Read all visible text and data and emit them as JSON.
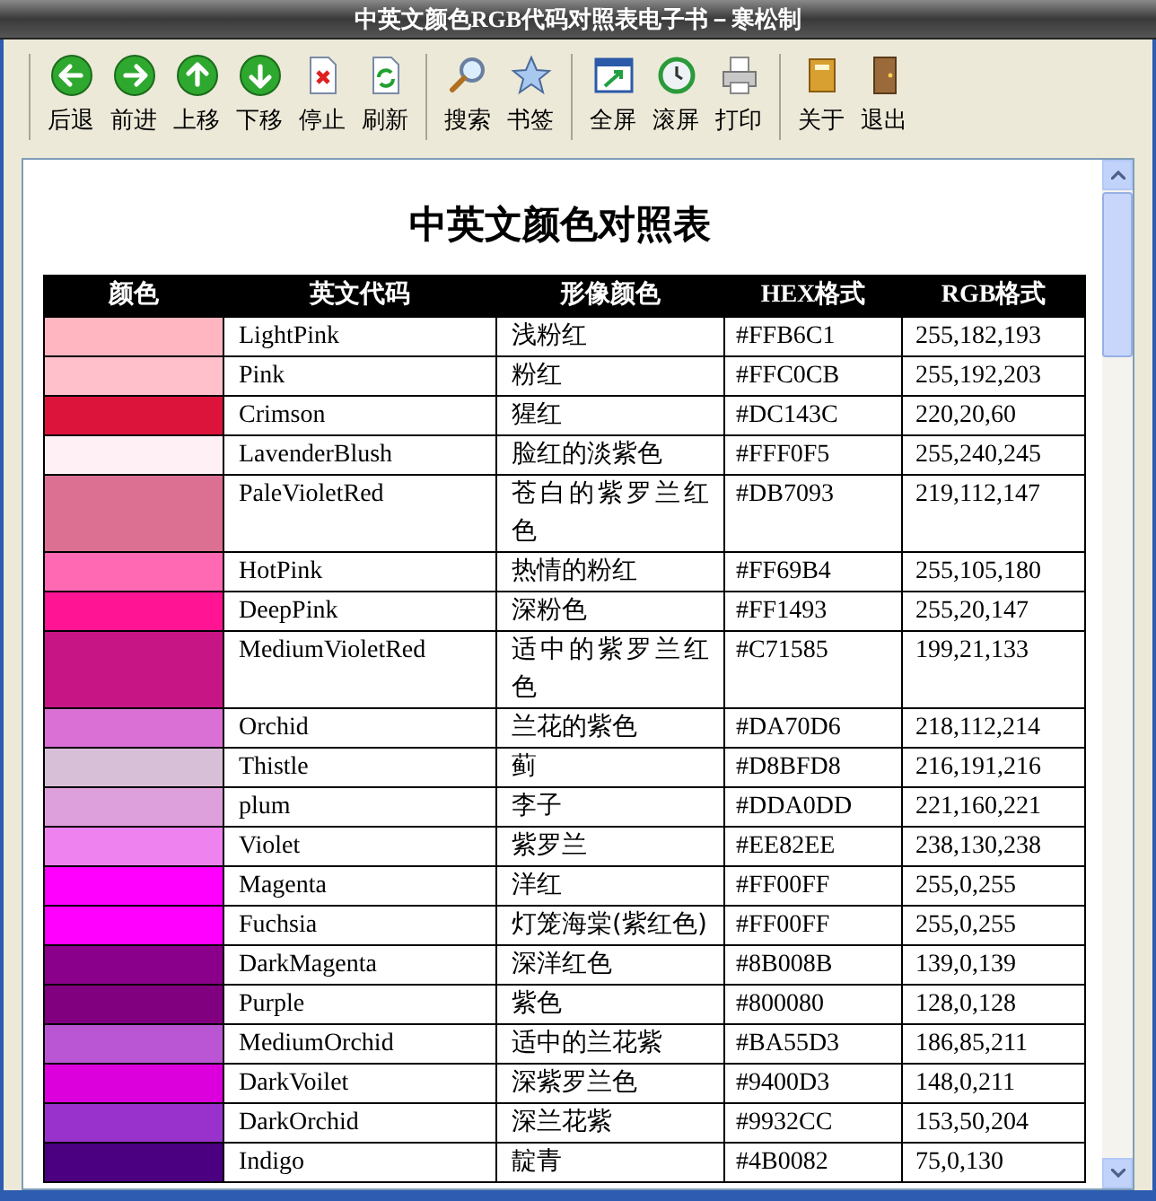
{
  "window": {
    "title": "中英文颜色RGB代码对照表电子书－寒松制"
  },
  "toolbar": [
    [
      {
        "label": "后退",
        "kind": "back"
      },
      {
        "label": "前进",
        "kind": "forward"
      },
      {
        "label": "上移",
        "kind": "up"
      },
      {
        "label": "下移",
        "kind": "down"
      },
      {
        "label": "停止",
        "kind": "stop"
      },
      {
        "label": "刷新",
        "kind": "refresh"
      }
    ],
    [
      {
        "label": "搜索",
        "kind": "search"
      },
      {
        "label": "书签",
        "kind": "star"
      }
    ],
    [
      {
        "label": "全屏",
        "kind": "fullscreen"
      },
      {
        "label": "滚屏",
        "kind": "scroll"
      },
      {
        "label": "打印",
        "kind": "print"
      }
    ],
    [
      {
        "label": "关于",
        "kind": "about"
      },
      {
        "label": "退出",
        "kind": "exit"
      }
    ]
  ],
  "page": {
    "heading": "中英文颜色对照表",
    "table": {
      "columns": [
        "颜色",
        "英文代码",
        "形像颜色",
        "HEX格式",
        "RGB格式"
      ],
      "rows": [
        {
          "color": "#ffb6c1",
          "name": "LightPink",
          "chinese": "浅粉红",
          "hex": "#FFB6C1",
          "rgb": "255,182,193"
        },
        {
          "color": "#ffc0cb",
          "name": "Pink",
          "chinese": "粉红",
          "hex": "#FFC0CB",
          "rgb": "255,192,203"
        },
        {
          "color": "#dc143c",
          "name": "Crimson",
          "chinese": "猩红",
          "hex": "#DC143C",
          "rgb": "220,20,60"
        },
        {
          "color": "#fff0f5",
          "name": "LavenderBlush",
          "chinese": "脸红的淡紫色",
          "hex": "#FFF0F5",
          "rgb": "255,240,245"
        },
        {
          "color": "#db7093",
          "name": "PaleVioletRed",
          "chinese": "苍白的紫罗兰红色",
          "hex": "#DB7093",
          "rgb": "219,112,147"
        },
        {
          "color": "#ff69b4",
          "name": "HotPink",
          "chinese": "热情的粉红",
          "hex": "#FF69B4",
          "rgb": "255,105,180"
        },
        {
          "color": "#ff1493",
          "name": "DeepPink",
          "chinese": "深粉色",
          "hex": "#FF1493",
          "rgb": "255,20,147"
        },
        {
          "color": "#c71585",
          "name": "MediumVioletRed",
          "chinese": "适中的紫罗兰红色",
          "hex": "#C71585",
          "rgb": "199,21,133"
        },
        {
          "color": "#da70d6",
          "name": "Orchid",
          "chinese": "兰花的紫色",
          "hex": "#DA70D6",
          "rgb": "218,112,214"
        },
        {
          "color": "#d8bfd8",
          "name": "Thistle",
          "chinese": "蓟",
          "hex": "#D8BFD8",
          "rgb": "216,191,216"
        },
        {
          "color": "#dda0dd",
          "name": "plum",
          "chinese": "李子",
          "hex": "#DDA0DD",
          "rgb": "221,160,221"
        },
        {
          "color": "#ee82ee",
          "name": "Violet",
          "chinese": "紫罗兰",
          "hex": "#EE82EE",
          "rgb": "238,130,238"
        },
        {
          "color": "#ff00ff",
          "name": "Magenta",
          "chinese": "洋红",
          "hex": "#FF00FF",
          "rgb": "255,0,255"
        },
        {
          "color": "#ff00ff",
          "name": "Fuchsia",
          "chinese": "灯笼海棠(紫红色)",
          "hex": "#FF00FF",
          "rgb": "255,0,255"
        },
        {
          "color": "#8b008b",
          "name": "DarkMagenta",
          "chinese": "深洋红色",
          "hex": "#8B008B",
          "rgb": "139,0,139"
        },
        {
          "color": "#800080",
          "name": "Purple",
          "chinese": "紫色",
          "hex": "#800080",
          "rgb": "128,0,128"
        },
        {
          "color": "#ba55d3",
          "name": "MediumOrchid",
          "chinese": "适中的兰花紫",
          "hex": "#BA55D3",
          "rgb": "186,85,211"
        },
        {
          "color": "#dc00dc",
          "name": "DarkVoilet",
          "chinese": "深紫罗兰色",
          "hex": "#9400D3",
          "rgb": "148,0,211"
        },
        {
          "color": "#9932cc",
          "name": "DarkOrchid",
          "chinese": "深兰花紫",
          "hex": "#9932CC",
          "rgb": "153,50,204"
        },
        {
          "color": "#4b0082",
          "name": "Indigo",
          "chinese": "靛青",
          "hex": "#4B0082",
          "rgb": "75,0,130"
        }
      ]
    }
  }
}
